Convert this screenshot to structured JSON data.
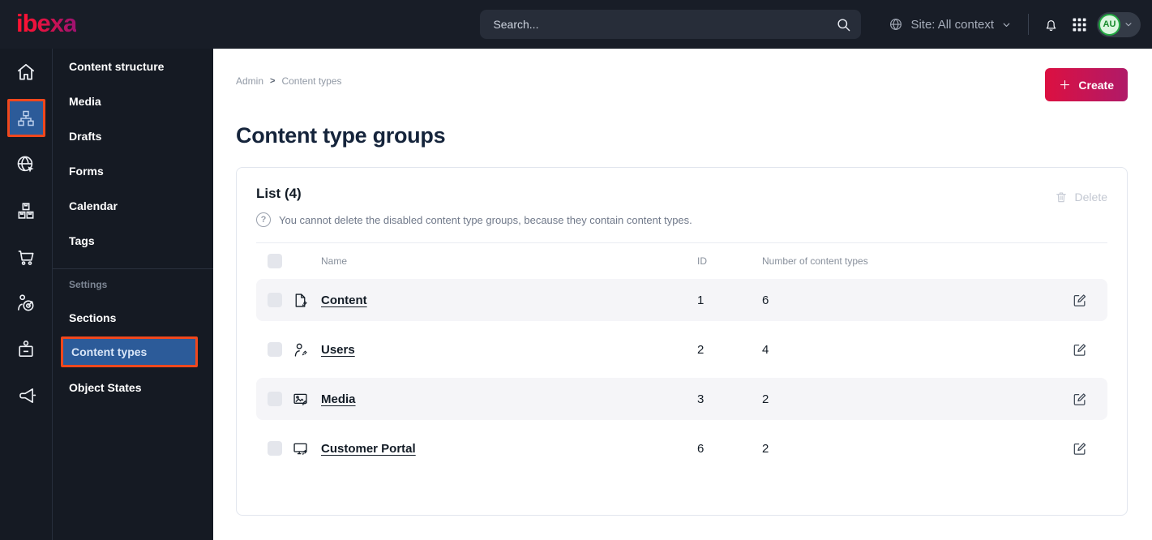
{
  "colors": {
    "topbar_bg": "#181d27",
    "sidebar_bg": "#151a23",
    "active_blue": "#2c5b99",
    "highlight_orange": "#f0471c",
    "create_gradient_start": "#dc1041",
    "create_gradient_end": "#b01a68",
    "avatar_green": "#23a942",
    "text_dark": "#131c26",
    "text_muted": "#878f9b",
    "row_alt_bg": "#f5f5f8"
  },
  "topbar": {
    "logo_text": "ibexa",
    "search_placeholder": "Search...",
    "search_icon": "search-icon",
    "site_context_label": "Site: All context",
    "site_context_icon": "globe-icon",
    "notification_icon": "bell-icon",
    "apps_icon": "app-grid-icon",
    "avatar_initials": "AU"
  },
  "icon_rail": {
    "items": [
      {
        "icon": "home-icon",
        "active": false
      },
      {
        "icon": "content-structure-icon",
        "active": true
      },
      {
        "icon": "site-globe-icon",
        "active": false
      },
      {
        "icon": "product-boxes-icon",
        "active": false
      },
      {
        "icon": "commerce-cart-icon",
        "active": false
      },
      {
        "icon": "personalization-target-icon",
        "active": false
      },
      {
        "icon": "corporate-badge-icon",
        "active": false
      },
      {
        "icon": "campaign-megaphone-icon",
        "active": false
      }
    ]
  },
  "sidebar": {
    "items": [
      {
        "label": "Content structure"
      },
      {
        "label": "Media"
      },
      {
        "label": "Drafts"
      },
      {
        "label": "Forms"
      },
      {
        "label": "Calendar"
      },
      {
        "label": "Tags"
      }
    ],
    "settings_header": "Settings",
    "settings_items": [
      {
        "label": "Sections",
        "active": false
      },
      {
        "label": "Content types",
        "active": true
      },
      {
        "label": "Object States",
        "active": false
      }
    ]
  },
  "main": {
    "breadcrumb": {
      "items": [
        "Admin",
        "Content types"
      ],
      "separator": ">"
    },
    "create_button_label": "Create",
    "page_title": "Content type groups",
    "card": {
      "list_title": "List (4)",
      "info_icon": "question-circle-icon",
      "info_text": "You cannot delete the disabled content type groups, because they contain content types.",
      "delete_button_label": "Delete",
      "delete_icon": "trash-icon",
      "table": {
        "headers": {
          "name": "Name",
          "id": "ID",
          "count": "Number of content types"
        },
        "rows": [
          {
            "icon": "file-edit-icon",
            "name": "Content",
            "id": "1",
            "count": "6"
          },
          {
            "icon": "user-edit-icon",
            "name": "Users",
            "id": "2",
            "count": "4"
          },
          {
            "icon": "image-edit-icon",
            "name": "Media",
            "id": "3",
            "count": "2"
          },
          {
            "icon": "monitor-edit-icon",
            "name": "Customer Portal",
            "id": "6",
            "count": "2"
          }
        ]
      }
    }
  }
}
